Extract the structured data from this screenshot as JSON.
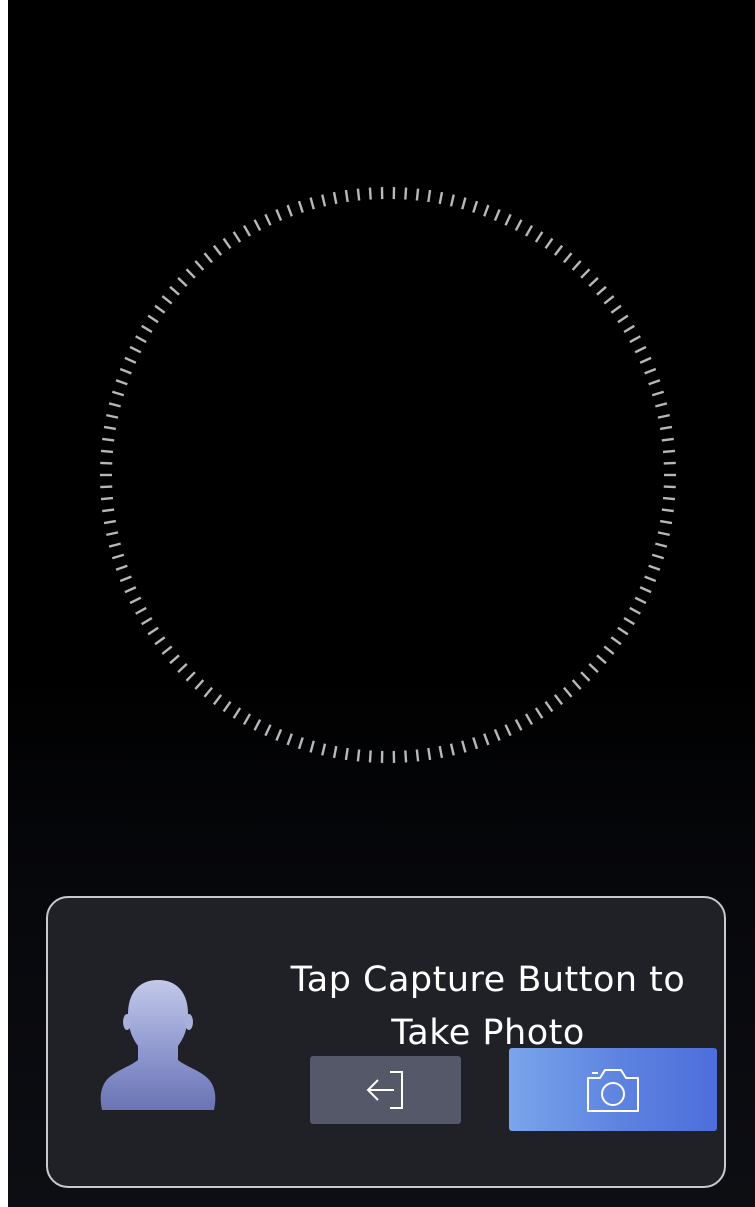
{
  "prompt": {
    "line1": "Tap Capture Button to",
    "line2": "Take Photo"
  },
  "icons": {
    "avatar": "person-silhouette-icon",
    "exit": "exit-arrow-icon",
    "capture": "camera-icon"
  },
  "colors": {
    "background": "#000000",
    "panel": "#202127",
    "panel_border": "#c9cad0",
    "ring_ticks": "#b8b8bc",
    "exit_button": "#545868",
    "capture_button_start": "#7aa5ea",
    "capture_button_end": "#4d6edb",
    "text": "#ffffff"
  }
}
